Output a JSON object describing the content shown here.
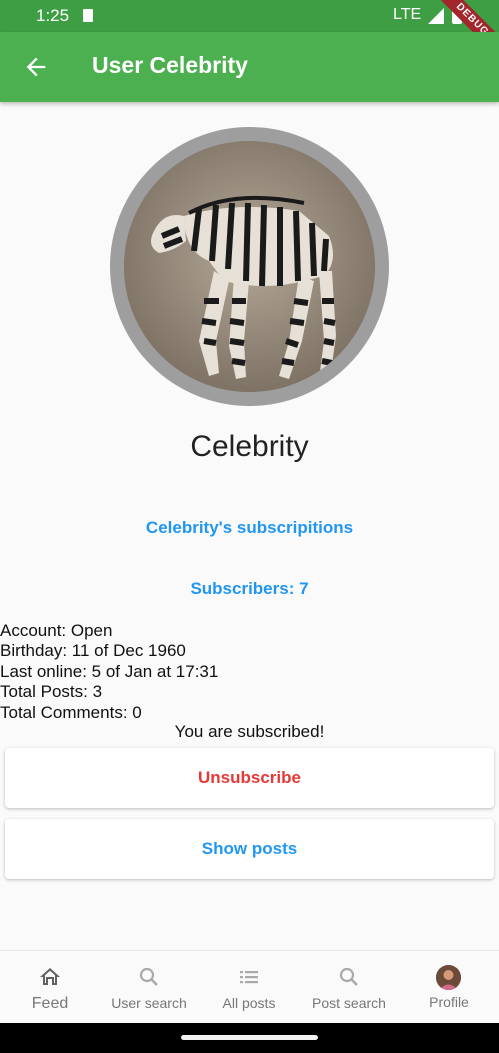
{
  "status_bar": {
    "time": "1:25",
    "network": "LTE"
  },
  "debug_banner": "DEBUG",
  "app_bar": {
    "title": "User Celebrity"
  },
  "profile": {
    "name": "Celebrity",
    "subscriptions_link": "Celebrity's subscripitions",
    "subscribers_link": "Subscribers: 7",
    "info": {
      "account": "Account: Open",
      "birthday": "Birthday: 11 of Dec 1960",
      "last_online": "Last online: 5 of Jan at 17:31",
      "total_posts": "Total Posts: 3",
      "total_comments": "Total Comments: 0"
    },
    "subscribed_note": "You are subscribed!"
  },
  "buttons": {
    "unsubscribe": "Unsubscribe",
    "show_posts": "Show posts"
  },
  "bottom_nav": {
    "items": [
      {
        "label": "Feed",
        "icon": "home-icon",
        "active": true
      },
      {
        "label": "User search",
        "icon": "search-icon"
      },
      {
        "label": "All posts",
        "icon": "list-icon"
      },
      {
        "label": "Post search",
        "icon": "search-icon"
      },
      {
        "label": "Profile",
        "icon": "avatar"
      }
    ]
  },
  "colors": {
    "app_bar": "#4caf50",
    "status_bar": "#3e9e43",
    "link": "#2196f3",
    "danger": "#e53935",
    "avatar_ring": "#9e9e9e"
  }
}
